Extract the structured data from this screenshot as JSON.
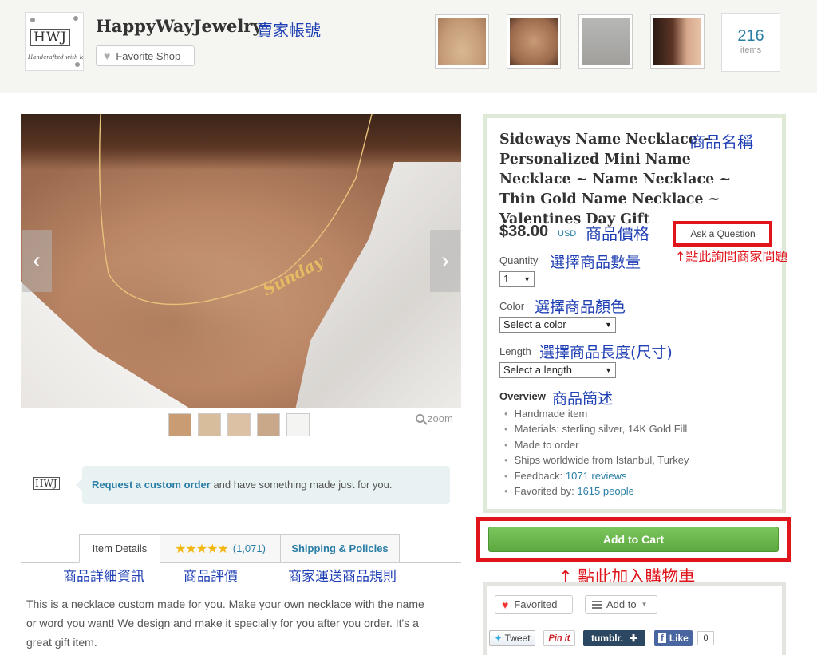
{
  "shop": {
    "name": "HappyWayJewelry",
    "logo_text": "HWJ",
    "logo_tagline": "Handcrafted with love",
    "annotation": "賣家帳號",
    "favorite_label": "Favorite Shop",
    "items_count": "216",
    "items_label": "items"
  },
  "listing": {
    "title": "Sideways Name Necklace ~ Personalized Mini Name Necklace ~ Name Necklace ~ Thin Gold Name Necklace ~ Valentines Day Gift",
    "title_annotation": "商品名稱",
    "price": "$38.00",
    "currency": "USD",
    "price_annotation": "商品價格",
    "ask_question": "Ask a Question",
    "ask_annotation": "↑點此詢問商家問題",
    "quantity_label": "Quantity",
    "quantity_value": "1",
    "quantity_annotation": "選擇商品數量",
    "color_label": "Color",
    "color_placeholder": "Select a color",
    "color_annotation": "選擇商品顏色",
    "length_label": "Length",
    "length_placeholder": "Select a length",
    "length_annotation": "選擇商品長度(尺寸)",
    "overview_label": "Overview",
    "overview_annotation": "商品簡述",
    "overview_items": [
      "Handmade item",
      "Materials: sterling silver, 14K Gold Fill",
      "Made to order",
      "Ships worldwide from Istanbul, Turkey"
    ],
    "feedback_label": "Feedback:",
    "feedback_link": "1071 reviews",
    "favorited_label": "Favorited by:",
    "favorited_link": "1615 people",
    "add_to_cart": "Add to Cart",
    "cart_annotation": "↑ 點此加入購物車"
  },
  "image": {
    "necklace_text": "Sunday",
    "zoom_label": "zoom"
  },
  "custom": {
    "link": "Request a custom order",
    "text": " and have something made just for you."
  },
  "tabs": {
    "item_details": "Item Details",
    "stars": "★★★★★",
    "reviews_count": "(1,071)",
    "shipping": "Shipping & Policies",
    "annot_details": "商品詳細資訊",
    "annot_reviews": "商品評價",
    "annot_shipping": "商家運送商品規則"
  },
  "description": "This is a necklace custom made for you. Make your own necklace with the name or word you want! We design and make it specially for you after you order. It's a great gift item.",
  "social": {
    "favorited": "Favorited",
    "add_to": "Add to",
    "tweet": "Tweet",
    "pinit": "Pin it",
    "tumblr": "tumblr.",
    "fb_like": "Like",
    "fb_count": "0"
  },
  "colors": {
    "link": "#2a7ea6",
    "annotation_blue": "#1f3fb4",
    "annotation_red": "#e0141b",
    "cart_green": "#6cb94f",
    "panel_border": "#dfe9d8"
  }
}
